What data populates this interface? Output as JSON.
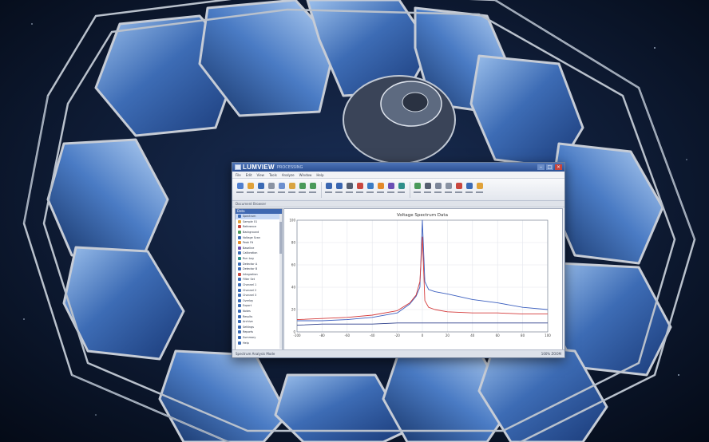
{
  "window": {
    "app_name": "LUMVIEW",
    "subtitle": "PROCESSING",
    "controls": [
      "–",
      "□",
      "×"
    ]
  },
  "menubar": {
    "items": [
      "File",
      "Edit",
      "View",
      "Tools",
      "Analyze",
      "Window",
      "Help"
    ]
  },
  "toolbar": {
    "icons": [
      {
        "name": "new-icon",
        "color": "#4f7fcf"
      },
      {
        "name": "open-icon",
        "color": "#e0a23a"
      },
      {
        "name": "save-icon",
        "color": "#3b6bb5"
      },
      {
        "name": "cut-icon",
        "color": "#8a93a3"
      },
      {
        "name": "copy-icon",
        "color": "#6c8fcf"
      },
      {
        "name": "paste-icon",
        "color": "#d9a441"
      },
      {
        "name": "undo-icon",
        "color": "#4a9a5a"
      },
      {
        "name": "redo-icon",
        "color": "#4a9a5a"
      },
      {
        "name": "zoom-in-icon",
        "color": "#3a66b0"
      },
      {
        "name": "zoom-out-icon",
        "color": "#3a66b0"
      },
      {
        "name": "cursor-icon",
        "color": "#555e70"
      },
      {
        "name": "peak-icon",
        "color": "#c9483f"
      },
      {
        "name": "baseline-icon",
        "color": "#3b7cc4"
      },
      {
        "name": "fit-icon",
        "color": "#e38a2b"
      },
      {
        "name": "integrate-icon",
        "color": "#6a4fb5"
      },
      {
        "name": "filter-icon",
        "color": "#2f8f8a"
      },
      {
        "name": "export-icon",
        "color": "#4a9a5a"
      },
      {
        "name": "print-icon",
        "color": "#555e70"
      },
      {
        "name": "grid-icon",
        "color": "#7c8699"
      },
      {
        "name": "settings-icon",
        "color": "#8a93a3"
      },
      {
        "name": "chart-icon",
        "color": "#c9483f"
      },
      {
        "name": "table-icon",
        "color": "#3b6bb5"
      },
      {
        "name": "help-icon",
        "color": "#e0a23a"
      }
    ]
  },
  "subbar": {
    "label": "Document Browser"
  },
  "sidebar": {
    "header": "Data",
    "items": [
      {
        "label": "Spectrum",
        "color": "#3b6bb5"
      },
      {
        "label": "Sample 01",
        "color": "#e0a23a"
      },
      {
        "label": "Reference",
        "color": "#c9483f"
      },
      {
        "label": "Background",
        "color": "#4a9a5a"
      },
      {
        "label": "Voltage Scan",
        "color": "#3b6bb5"
      },
      {
        "label": "Peak Fit",
        "color": "#e38a2b"
      },
      {
        "label": "Baseline",
        "color": "#6a4fb5"
      },
      {
        "label": "Calibration",
        "color": "#3b6bb5"
      },
      {
        "label": "Run Log",
        "color": "#2f8f8a"
      },
      {
        "label": "Detector A",
        "color": "#3b6bb5"
      },
      {
        "label": "Detector B",
        "color": "#3b6bb5"
      },
      {
        "label": "Integration",
        "color": "#c9483f"
      },
      {
        "label": "Filter Set",
        "color": "#3b6bb5"
      },
      {
        "label": "Channel 1",
        "color": "#3b6bb5"
      },
      {
        "label": "Channel 2",
        "color": "#3b6bb5"
      },
      {
        "label": "Channel 3",
        "color": "#3b6bb5"
      },
      {
        "label": "Overlay",
        "color": "#3b6bb5"
      },
      {
        "label": "Export",
        "color": "#3b6bb5"
      },
      {
        "label": "Notes",
        "color": "#3b6bb5"
      },
      {
        "label": "Results",
        "color": "#3b6bb5"
      },
      {
        "label": "Archive",
        "color": "#3b6bb5"
      },
      {
        "label": "Settings",
        "color": "#3b6bb5"
      },
      {
        "label": "Reports",
        "color": "#3b6bb5"
      },
      {
        "label": "Summary",
        "color": "#3b6bb5"
      },
      {
        "label": "Help",
        "color": "#3b6bb5"
      }
    ]
  },
  "chart_data": {
    "type": "line",
    "title": "Voltage Spectrum Data",
    "xlabel": "",
    "ylabel": "",
    "xlim": [
      -100,
      100
    ],
    "ylim": [
      0,
      100
    ],
    "xticks": [
      -100,
      -80,
      -60,
      -40,
      -20,
      0,
      20,
      40,
      60,
      80,
      100
    ],
    "yticks": [
      0,
      20,
      40,
      60,
      80,
      100
    ],
    "grid": true,
    "series": [
      {
        "color": "#3b5fbf",
        "x": [
          -100,
          -80,
          -60,
          -40,
          -20,
          -10,
          -5,
          -2,
          0,
          2,
          5,
          10,
          20,
          40,
          60,
          80,
          100
        ],
        "y": [
          10,
          10,
          11,
          13,
          17,
          25,
          32,
          40,
          100,
          45,
          38,
          36,
          34,
          29,
          26,
          22,
          20
        ]
      },
      {
        "color": "#d43a3a",
        "x": [
          -100,
          -80,
          -60,
          -40,
          -20,
          -10,
          -5,
          -2,
          0,
          2,
          5,
          10,
          20,
          40,
          60,
          80,
          100
        ],
        "y": [
          11,
          12,
          13,
          15,
          19,
          26,
          33,
          45,
          85,
          28,
          22,
          20,
          18,
          17,
          17,
          16,
          16
        ]
      },
      {
        "color": "#2c3e8a",
        "x": [
          -100,
          -80,
          -60,
          -40,
          -20,
          0,
          20,
          40,
          60,
          80,
          100
        ],
        "y": [
          6,
          7,
          7,
          7,
          8,
          8,
          8,
          8,
          8,
          8,
          8
        ]
      }
    ]
  },
  "statusbar": {
    "left": "Spectrum Analysis Mode",
    "right": "100% ZOOM"
  }
}
